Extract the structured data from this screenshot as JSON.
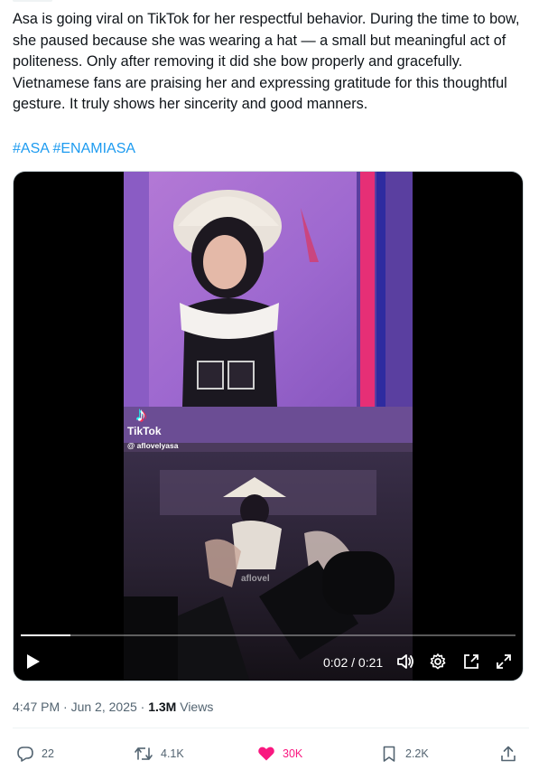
{
  "tweet": {
    "text": "Asa is going viral on TikTok for her respectful behavior. During the time to bow, she paused because she was wearing a hat — a small but meaningful act of politeness. Only after removing it did she bow properly and gracefully. Vietnamese fans are praising her and expressing gratitude for this thoughtful gesture. It truly shows her sincerity and good manners.",
    "hashtags": [
      "#ASA",
      "#ENAMIASA"
    ]
  },
  "video": {
    "overlay_brand": "TikTok",
    "overlay_handle": "@ aflovelyasa",
    "watermark": "aflovel",
    "time_current": "0:02",
    "time_separator": " / ",
    "time_total": "0:21",
    "progress_fraction": 0.1,
    "controls": {
      "play_icon": "play-icon",
      "volume_icon": "volume-icon",
      "settings_icon": "gear-icon",
      "pip_icon": "picture-in-picture-icon",
      "fullscreen_icon": "fullscreen-icon"
    }
  },
  "meta": {
    "time": "4:47 PM",
    "separator": " · ",
    "date": "Jun 2, 2025",
    "views_count": "1.3M",
    "views_label": "Views"
  },
  "actions": {
    "replies": "22",
    "retweets": "4.1K",
    "likes": "30K",
    "bookmarks": "2.2K"
  },
  "colors": {
    "link": "#1d9bf0",
    "like": "#f91880",
    "muted": "#536471",
    "text": "#0f1419"
  }
}
